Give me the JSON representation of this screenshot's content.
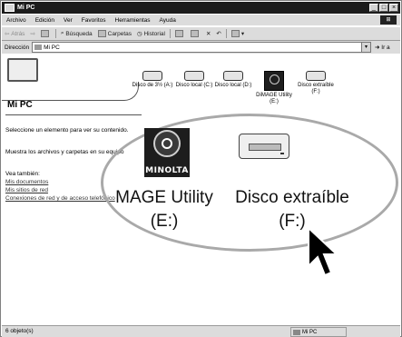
{
  "window": {
    "title": "Mi PC"
  },
  "menu": [
    "Archivo",
    "Edición",
    "Ver",
    "Favoritos",
    "Herramientas",
    "Ayuda"
  ],
  "toolbar": {
    "back": "Atrás",
    "search": "Búsqueda",
    "folders": "Carpetas",
    "history": "Historial"
  },
  "address": {
    "label": "Dirección",
    "value": "Mi PC",
    "go": "Ir a"
  },
  "left_pane": {
    "title": "Mi PC",
    "hint": "Seleccione un elemento para ver su contenido.",
    "hint2": "Muestra los archivos y carpetas en su equipo",
    "see_also": "Vea también:",
    "links": [
      "Mis documentos",
      "Mis sitios de red",
      "Conexiones de red y de acceso telefónico"
    ]
  },
  "icons": [
    {
      "label": "Disco de 3½ (A:)",
      "icon": "floppy-drive-icon"
    },
    {
      "label": "Disco local (C:)",
      "icon": "hard-drive-icon"
    },
    {
      "label": "Disco local (D:)",
      "icon": "hard-drive-icon"
    },
    {
      "label": "DiMAGE Utility (E:)",
      "icon": "cd-drive-icon"
    },
    {
      "label": "Disco extraíble (F:)",
      "icon": "removable-disk-icon"
    }
  ],
  "callout": {
    "left_label_1": "MAGE Utility",
    "left_label_2": "(E:)",
    "right_label_1": "Disco extraíble",
    "right_label_2": "(F:)",
    "brand": "MINOLTA"
  },
  "status": {
    "count": "6 objeto(s)",
    "zone": "Mi PC"
  }
}
